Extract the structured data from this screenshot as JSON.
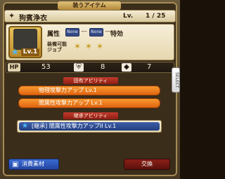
{
  "header": {
    "ribbon": "装うアイテム"
  },
  "item": {
    "name": "狗賓浄衣",
    "lv_label": "Lv.",
    "lv_value": "1 / 25",
    "level_badge": "Lv.1",
    "attr_label": "属性",
    "tag_1": "None",
    "tag_2": "None",
    "special_label": "特効",
    "job_label": "装備可能\nジョブ"
  },
  "stats": {
    "hp_label": "HP",
    "hp": "53",
    "defense": "8",
    "other": "7"
  },
  "sections": {
    "fixed_title": "固有アビリティ",
    "learn_title": "継承アビリティ"
  },
  "abilities": [
    {
      "text": "物理攻撃力アップ Lv.1"
    },
    {
      "text": "闇属性攻撃力アップ Lv.1"
    }
  ],
  "passive": {
    "text": "[継承] 闇属性攻撃力アップII Lv.1"
  },
  "side_tab": {
    "label": "SELECT"
  },
  "buttons": {
    "left": "消費素材",
    "right": "交換"
  },
  "colors": {
    "accent": "#e07a1e",
    "blue": "#2446a3",
    "red": "#8a1f16"
  }
}
